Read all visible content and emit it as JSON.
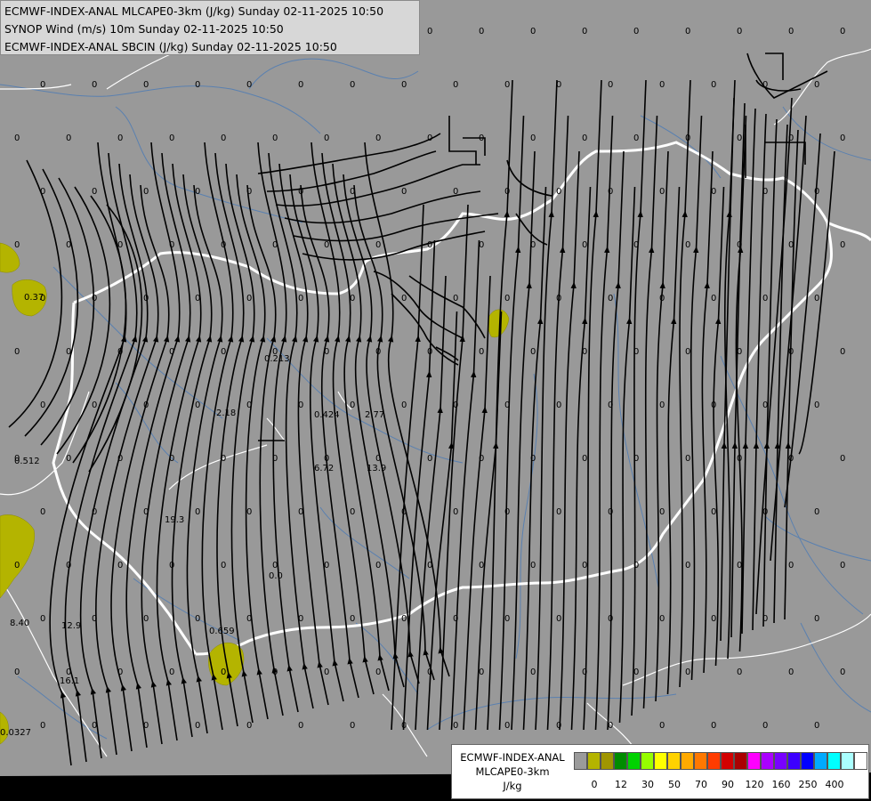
{
  "header": {
    "line1": "ECMWF-INDEX-ANAL MLCAPE0-3km (J/kg) Sunday 02-11-2025 10:50",
    "line2": "SYNOP Wind (m/s) 10m Sunday 02-11-2025 10:50",
    "line3": "ECMWF-INDEX-ANAL SBCIN (J/kg) Sunday 02-11-2025 10:50"
  },
  "legend": {
    "title1": "ECMWF-INDEX-ANAL",
    "title2": "MLCAPE0-3km",
    "unit": "J/kg",
    "colors": [
      "#9b9b9b",
      "#b4b400",
      "#a09600",
      "#008c00",
      "#00d200",
      "#96ff00",
      "#ffff00",
      "#ffd200",
      "#ffaa00",
      "#ff7800",
      "#ff3c00",
      "#d20000",
      "#aa0000",
      "#ff00ff",
      "#aa00ff",
      "#7800ff",
      "#3c00ff",
      "#0000ff",
      "#00aaff",
      "#00ffff",
      "#aaffff",
      "#ffffff"
    ],
    "ticks": [
      "0",
      "12",
      "30",
      "50",
      "70",
      "90",
      "120",
      "160",
      "250",
      "400"
    ]
  },
  "map": {
    "background": "#999999",
    "border_color": "#ffffff",
    "river_color": "#5a80b0",
    "cape_color": "#b4b400",
    "cin_labels": [
      "0.37",
      "0.213",
      "2.18",
      "0.424",
      "2.77",
      "0.512",
      "6.72",
      "13.9",
      "19.3",
      "0.0",
      "8.40",
      "12.9",
      "16.1",
      "0.659",
      "0.0327"
    ]
  }
}
